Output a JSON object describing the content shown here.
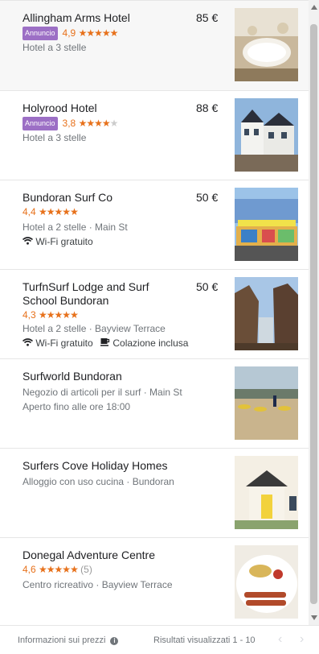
{
  "listings": [
    {
      "name": "Allingham Arms Hotel",
      "price": "85 €",
      "ad": "Annuncio",
      "rating": "4,9",
      "stars": "★★★★★",
      "stars_empty": "",
      "reviews": "",
      "details": "Hotel a 3 stelle",
      "amenities": []
    },
    {
      "name": "Holyrood Hotel",
      "price": "88 €",
      "ad": "Annuncio",
      "rating": "3,8",
      "stars": "★★★★",
      "stars_empty": "★",
      "reviews": "",
      "details": "Hotel a 3 stelle",
      "amenities": []
    },
    {
      "name": "Bundoran Surf Co",
      "price": "50 €",
      "ad": "",
      "rating": "4,4",
      "stars": "★★★★★",
      "stars_empty": "",
      "reviews": "",
      "details": "Hotel a 2 stelle · Main St",
      "amenities": [
        "Wi-Fi gratuito"
      ]
    },
    {
      "name": "TurfnSurf Lodge and Surf School Bundoran",
      "price": "50 €",
      "ad": "",
      "rating": "4,3",
      "stars": "★★★★★",
      "stars_empty": "",
      "reviews": "",
      "details": "Hotel a 2 stelle · Bayview Terrace",
      "amenities": [
        "Wi-Fi gratuito",
        "Colazione inclusa"
      ]
    },
    {
      "name": "Surfworld Bundoran",
      "price": "",
      "ad": "",
      "rating": "",
      "stars": "",
      "stars_empty": "",
      "reviews": "",
      "details": "Negozio di articoli per il surf · Main St",
      "extra": "Aperto fino alle ore 18:00",
      "amenities": []
    },
    {
      "name": "Surfers Cove Holiday Homes",
      "price": "",
      "ad": "",
      "rating": "",
      "stars": "",
      "stars_empty": "",
      "reviews": "",
      "details": "Alloggio con uso cucina · Bundoran",
      "amenities": []
    },
    {
      "name": "Donegal Adventure Centre",
      "price": "",
      "ad": "",
      "rating": "4,6",
      "stars": "★★★★★",
      "stars_empty": "",
      "reviews": "(5)",
      "details": "Centro ricreativo · Bayview Terrace",
      "amenities": []
    }
  ],
  "footer": {
    "price_info": "Informazioni sui prezzi",
    "info_icon": "i",
    "results": "Risultati visualizzati 1 - 10",
    "prev": "‹",
    "next": "›"
  },
  "colors": {
    "rating": "#e7711b",
    "ad_badge": "#9c6fc5"
  }
}
